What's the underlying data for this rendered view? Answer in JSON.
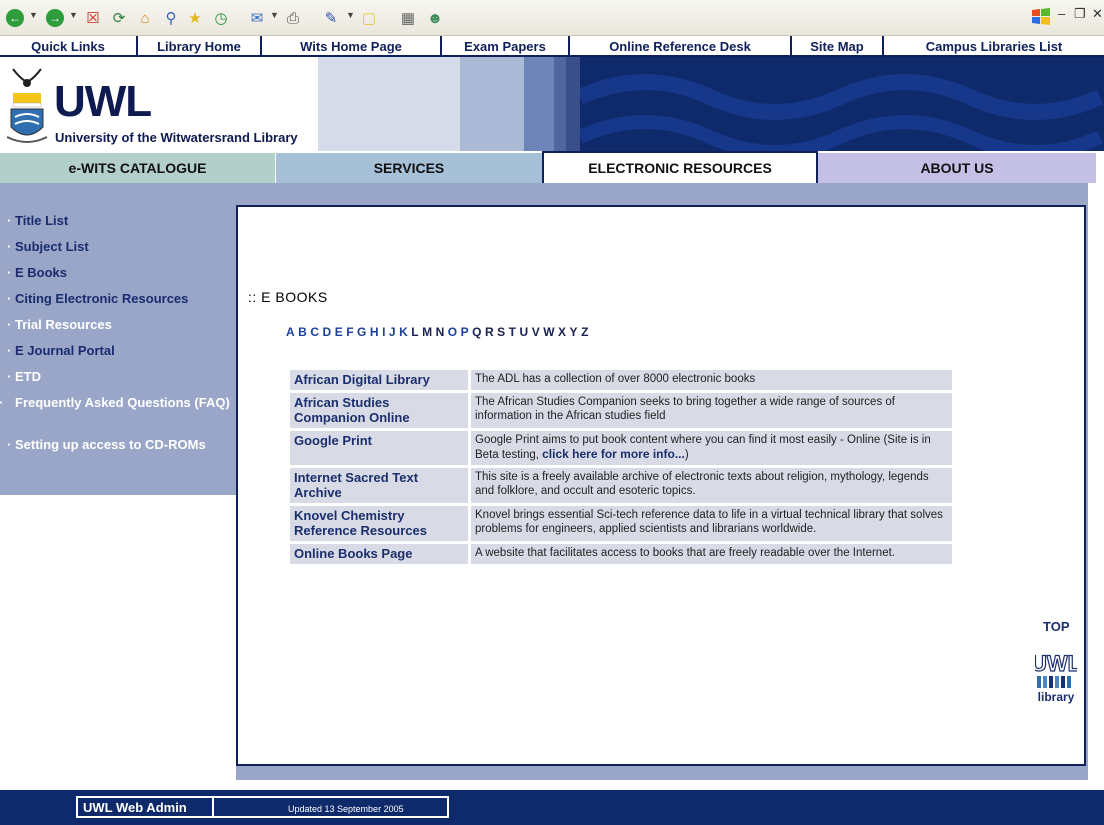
{
  "toplinks": [
    {
      "label": "Quick Links"
    },
    {
      "label": "Library Home"
    },
    {
      "label": "Wits Home Page"
    },
    {
      "label": "Exam Papers"
    },
    {
      "label": "Online Reference Desk"
    },
    {
      "label": "Site Map"
    },
    {
      "label": "Campus Libraries List"
    }
  ],
  "banner": {
    "logo_text": "UWL",
    "logo_subtitle": "University of the Witwatersrand Library"
  },
  "tabs": [
    {
      "label": "e-WITS CATALOGUE"
    },
    {
      "label": "SERVICES"
    },
    {
      "label": "ELECTRONIC RESOURCES"
    },
    {
      "label": "ABOUT US"
    }
  ],
  "sidebar": {
    "items": [
      {
        "label": "Title List"
      },
      {
        "label": "Subject List"
      },
      {
        "label": "E Books"
      },
      {
        "label": "Citing Electronic Resources"
      },
      {
        "label": "Trial Resources"
      },
      {
        "label": "E Journal Portal"
      },
      {
        "label": "ETD"
      },
      {
        "label": "Frequently Asked Questions (FAQ)"
      },
      {
        "label": "Setting up access to CD-ROMs"
      }
    ]
  },
  "content": {
    "heading": ":: E BOOKS",
    "alphabet": [
      "A",
      "B",
      "C",
      "D",
      "E",
      "F",
      "G",
      "H",
      "I",
      "J",
      "K",
      "L",
      "M",
      "N",
      "O",
      "P",
      "Q",
      "R",
      "S",
      "T",
      "U",
      "V",
      "W",
      "X",
      "Y",
      "Z"
    ],
    "resources": [
      {
        "name": "African Digital Library",
        "desc": "The ADL has a collection of over 8000 electronic books"
      },
      {
        "name": "African Studies Companion Online",
        "desc": "The African Studies Companion seeks to bring together a wide range of sources of information in the African studies field"
      },
      {
        "name": "Google Print",
        "desc": "Google Print aims to put book content where you can find it most easily - Online (Site is in Beta testing, ",
        "link": "click here for more info...",
        "tail": ")"
      },
      {
        "name": "Internet Sacred Text Archive",
        "desc": "This site is a freely available archive of electronic texts about religion, mythology, legends and folklore, and occult and esoteric topics."
      },
      {
        "name": "Knovel Chemistry Reference Resources",
        "desc": "Knovel brings essential Sci-tech reference data to life in a virtual technical library that solves problems for engineers, applied scientists and librarians worldwide."
      },
      {
        "name": "Online Books Page",
        "desc": "A website that facilitates access to books that are freely readable over the Internet."
      }
    ],
    "top_link": "TOP",
    "mini_logo_top": "UWL",
    "mini_logo_bottom": "library"
  },
  "footer": {
    "admin": "UWL Web Admin",
    "updated": "Updated 13 September 2005"
  },
  "colors": {
    "navy": "#10205a",
    "sidebar": "#9aa6c8",
    "tab_services": "#a6c0d8",
    "tab_catalogue": "#b3cfc9",
    "tab_about": "#c4bfe4"
  }
}
